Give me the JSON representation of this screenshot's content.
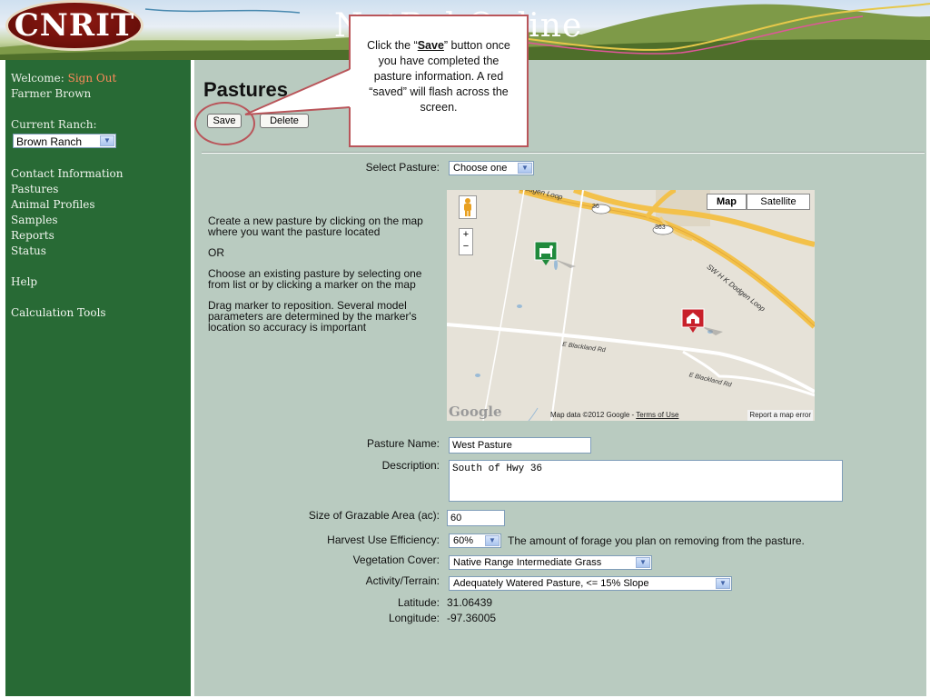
{
  "header": {
    "logo_text": "CNRIT",
    "banner_title": "NutBal Online"
  },
  "sidebar": {
    "welcome_label": "Welcome:",
    "sign_out": "Sign Out",
    "user_name": "Farmer Brown",
    "current_ranch_label": "Current Ranch:",
    "current_ranch_value": "Brown Ranch",
    "nav_group1": [
      "Contact Information",
      "Pastures",
      "Animal Profiles",
      "Samples",
      "Reports",
      "Status"
    ],
    "help": "Help",
    "calc_tools": "Calculation Tools"
  },
  "main": {
    "page_title": "Pastures",
    "save_label": "Save",
    "delete_label": "Delete",
    "select_pasture_label": "Select Pasture:",
    "select_pasture_value": "Choose one",
    "instructions": [
      "Create a new pasture by clicking on the map where you want the pasture located",
      "OR",
      "Choose an existing pasture by selecting one from list or by clicking a marker on the map",
      "Drag marker to reposition. Several model parameters are determined by the marker's location so accuracy is important"
    ],
    "map": {
      "map_btn": "Map",
      "satellite_btn": "Satellite",
      "google": "Google",
      "map_data_prefix": "Map data ©2012 Google - ",
      "terms": "Terms of Use",
      "report": "Report a map error",
      "roads": {
        "r1": "Dodgen Loop",
        "r2": "SW H K Dodgen Loop",
        "r3": "E Blackland Rd",
        "r4": "E Blackland Rd",
        "shield1": "36",
        "shield2": "363"
      }
    },
    "form": {
      "pasture_name_label": "Pasture Name:",
      "pasture_name_value": "West Pasture",
      "description_label": "Description:",
      "description_value": "South of Hwy 36",
      "size_label": "Size of Grazable Area (ac):",
      "size_value": "60",
      "harvest_label": "Harvest Use Efficiency:",
      "harvest_value": "60%",
      "harvest_note": "The amount of forage you plan on removing from the pasture.",
      "vegetation_label": "Vegetation Cover:",
      "vegetation_value": "Native Range Intermediate Grass",
      "activity_label": "Activity/Terrain:",
      "activity_value": "Adequately Watered Pasture, <= 15% Slope",
      "latitude_label": "Latitude:",
      "latitude_value": "31.06439",
      "longitude_label": "Longitude:",
      "longitude_value": "-97.36005"
    }
  },
  "callout": {
    "text_before": "Click the “",
    "text_bold": "Save",
    "text_after": "” button once you have completed the pasture information.  A red “saved” will flash across the screen."
  },
  "colors": {
    "sidebar_bg": "#286a35",
    "main_bg": "#b9cbc0",
    "sign_out": "#ff8a5a",
    "callout_border": "#b9555a"
  }
}
